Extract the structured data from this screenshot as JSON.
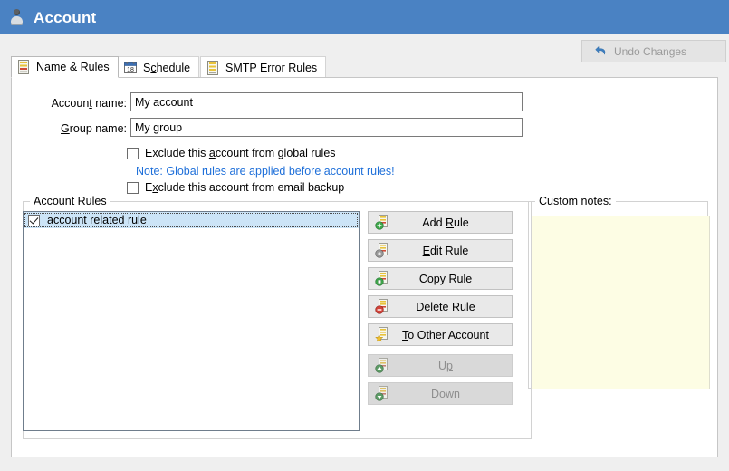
{
  "window": {
    "title": "Account",
    "icon": "user-icon",
    "titlebar_color": "#4a82c3"
  },
  "toolbar": {
    "undo_label": "Undo Changes",
    "undo_icon": "undo-arrow-icon",
    "undo_enabled": false
  },
  "tabs": [
    {
      "label": "Name & Rules",
      "icon": "rules-icon",
      "active": true
    },
    {
      "label": "Schedule",
      "icon": "calendar-icon",
      "active": false
    },
    {
      "label": "SMTP Error Rules",
      "icon": "smtp-rules-icon",
      "active": false
    }
  ],
  "form": {
    "account_name_label": "Account name:",
    "account_name_value": "My account",
    "group_name_label": "Group name:",
    "group_name_value": "My group",
    "exclude_global_label": "Exclude this account from global rules",
    "exclude_global_checked": false,
    "note": "Note: Global rules are applied before account rules!",
    "note_color": "#1e6fd9",
    "exclude_backup_label": "Exclude this account from email backup",
    "exclude_backup_checked": false
  },
  "account_rules": {
    "group_title": "Account Rules",
    "items": [
      {
        "label": "account related rule",
        "checked": true,
        "selected": true
      }
    ],
    "selection_color": "#cce4f7"
  },
  "rule_buttons": [
    {
      "label": "Add Rule",
      "icon": "rule-add-icon",
      "enabled": true
    },
    {
      "label": "Edit Rule",
      "icon": "rule-edit-icon",
      "enabled": true
    },
    {
      "label": "Copy Rule",
      "icon": "rule-copy-icon",
      "enabled": true
    },
    {
      "label": "Delete Rule",
      "icon": "rule-delete-icon",
      "enabled": true
    },
    {
      "label": "To Other Account",
      "icon": "rule-move-icon",
      "enabled": true
    },
    {
      "label": "Up",
      "icon": "rule-up-icon",
      "enabled": false
    },
    {
      "label": "Down",
      "icon": "rule-down-icon",
      "enabled": false
    }
  ],
  "custom_notes": {
    "group_title": "Custom notes:",
    "value": "",
    "background": "#fdfde4"
  }
}
